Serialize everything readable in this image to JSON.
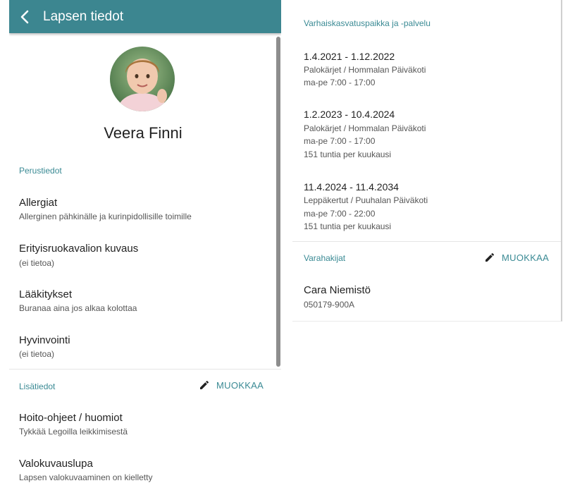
{
  "header": {
    "title": "Lapsen tiedot"
  },
  "child": {
    "name": "Veera Finni"
  },
  "basic_info": {
    "label": "Perustiedot",
    "items": [
      {
        "title": "Allergiat",
        "value": "Allerginen pähkinälle ja kurinpidollisille toimille"
      },
      {
        "title": "Erityisruokavalion kuvaus",
        "value": "(ei tietoa)"
      },
      {
        "title": "Lääkitykset",
        "value": "Buranaa aina jos alkaa kolottaa"
      },
      {
        "title": "Hyvinvointi",
        "value": "(ei tietoa)"
      }
    ]
  },
  "additional_info": {
    "label": "Lisätiedot",
    "edit_label": "MUOKKAA",
    "items": [
      {
        "title": "Hoito-ohjeet / huomiot",
        "value": "Tykkää Legoilla leikkimisestä"
      },
      {
        "title": "Valokuvauslupa",
        "value": "Lapsen valokuvaaminen on kielletty"
      }
    ]
  },
  "placements": {
    "label": "Varhaiskasvatuspaikka ja -palvelu",
    "periods": [
      {
        "dates": "1.4.2021 - 1.12.2022",
        "lines": [
          "Palokärjet / Hommalan Päiväkoti",
          "ma-pe 7:00 - 17:00"
        ]
      },
      {
        "dates": "1.2.2023 - 10.4.2024",
        "lines": [
          "Palokärjet / Hommalan Päiväkoti",
          "ma-pe 7:00 - 17:00",
          "151 tuntia per kuukausi"
        ]
      },
      {
        "dates": "11.4.2024 - 11.4.2034",
        "lines": [
          "Leppäkertut / Puuhalan Päiväkoti",
          "ma-pe 7:00 - 22:00",
          "151 tuntia per kuukausi"
        ]
      }
    ]
  },
  "guardians": {
    "label": "Varahakijat",
    "edit_label": "MUOKKAA",
    "items": [
      {
        "name": "Cara Niemistö",
        "id": "050179-900A"
      }
    ]
  },
  "colors": {
    "header": "#3c8690",
    "accent": "#3a8a94"
  },
  "icons": {
    "back": "chevron-left-icon",
    "edit": "pencil-icon"
  }
}
